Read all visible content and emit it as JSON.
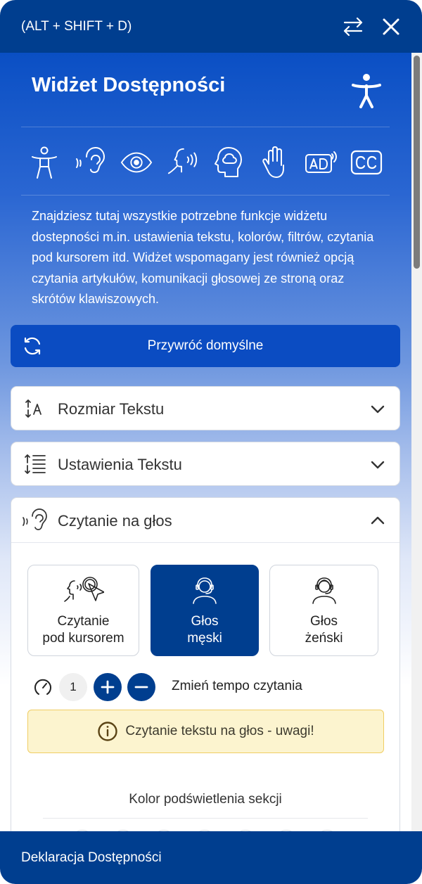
{
  "header": {
    "shortcut_text": "(ALT + SHIFT + D)",
    "swap_icon": "swap-arrows-icon",
    "close_icon": "close-icon"
  },
  "hero": {
    "title": "Widżet Dostępności",
    "figure_icon": "accessibility-person-icon",
    "feature_icons": [
      "accessibility-person-icon",
      "ear-icon",
      "eye-icon",
      "speaking-head-icon",
      "brain-head-icon",
      "hand-icon",
      "audio-description-icon",
      "closed-captions-icon"
    ],
    "description": "Znajdziesz tutaj wszystkie potrzebne funkcje widżetu dostepności m.in. ustawienia tekstu, kolorów, filtrów, czytania pod kursorem itd. Widżet wspomagany jest również opcją czytania artykułów, komunikacji głosowej ze stroną oraz skrótów klawiszowych."
  },
  "reset": {
    "label": "Przywróć domyślne",
    "icon": "refresh-icon"
  },
  "sections": [
    {
      "label": "Rozmiar Tekstu",
      "icon": "text-size-icon",
      "expanded": false
    },
    {
      "label": "Ustawienia Tekstu",
      "icon": "line-height-icon",
      "expanded": false
    },
    {
      "label": "Czytanie na głos",
      "icon": "ear-icon",
      "expanded": true
    }
  ],
  "reading": {
    "options": [
      {
        "label": "Czytanie\npod kursorem",
        "icon": "speaking-cursor-icon",
        "active": false
      },
      {
        "label": "Głos\nmęski",
        "icon": "male-headset-icon",
        "active": true
      },
      {
        "label": "Głos\nżeński",
        "icon": "female-headset-icon",
        "active": false
      }
    ],
    "tempo_value": "1",
    "tempo_label": "Zmień tempo czytania",
    "warning": "Czytanie tekstu na głos - uwagi!",
    "highlight_title": "Kolor podświetlenia sekcji"
  },
  "footer": {
    "label": "Deklaracja Dostępności"
  },
  "colors": {
    "primary": "#003e8f",
    "button_blue": "#0b4cc2",
    "warning_bg": "#fcf4cf"
  }
}
